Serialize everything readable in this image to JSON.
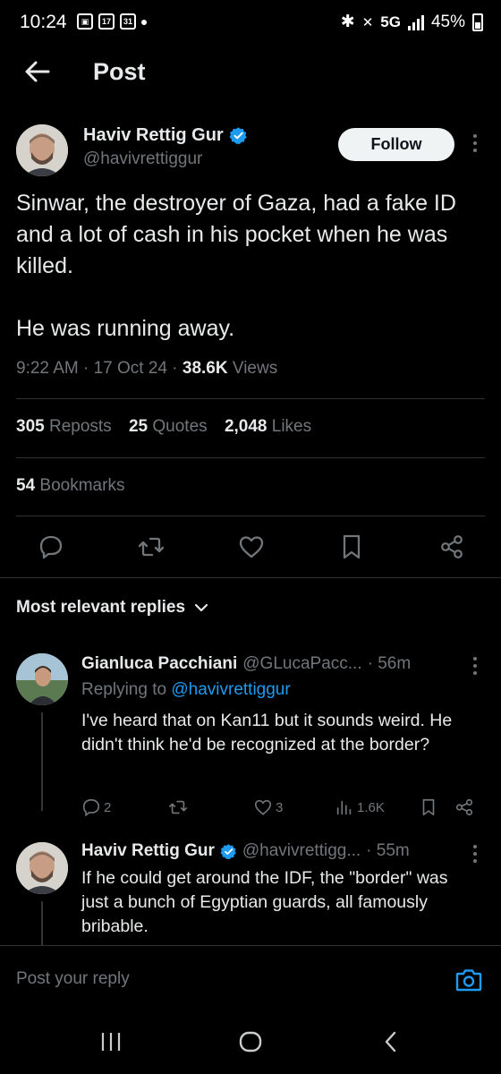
{
  "status_bar": {
    "time": "10:24",
    "cal_a": "17",
    "cal_b": "31",
    "network": "5G",
    "battery": "45%"
  },
  "header": {
    "title": "Post"
  },
  "post": {
    "author_name": "Haviv Rettig Gur",
    "author_handle": "@havivrettiggur",
    "follow_label": "Follow",
    "text_p1": "Sinwar, the destroyer of Gaza, had a fake ID and a lot of cash in his pocket when he was killed.",
    "text_p2": "He was running away.",
    "time": "9:22 AM",
    "date": "17 Oct 24",
    "views_count": "38.6K",
    "views_label": "Views",
    "reposts_count": "305",
    "reposts_label": "Reposts",
    "quotes_count": "25",
    "quotes_label": "Quotes",
    "likes_count": "2,048",
    "likes_label": "Likes",
    "bookmarks_count": "54",
    "bookmarks_label": "Bookmarks"
  },
  "replies_header": "Most relevant replies",
  "replies": [
    {
      "name": "Gianluca Pacchiani",
      "handle": "@GLucaPacc...",
      "time": "· 56m",
      "replying_prefix": "Replying to",
      "replying_to": "@havivrettiggur",
      "text": "I've heard that on Kan11 but it sounds weird. He didn't think he'd be recognized at the border?",
      "replies_count": "2",
      "likes_count": "3",
      "views_count": "1.6K"
    },
    {
      "name": "Haviv Rettig Gur",
      "handle": "@havivrettigg...",
      "time": "· 55m",
      "text": "If he could get around the IDF, the \"border\" was just a bunch of Egyptian guards, all famously bribable."
    }
  ],
  "composer": {
    "placeholder": "Post your reply"
  },
  "colors": {
    "background": "#000000",
    "text_primary": "#e7e9ea",
    "text_secondary": "#71767b",
    "accent_blue": "#1d9bf0",
    "divider": "#2f3336"
  },
  "icons": [
    "back-arrow-icon",
    "verified-badge-icon",
    "more-icon",
    "reply-icon",
    "repost-icon",
    "like-icon",
    "bookmark-icon",
    "share-icon",
    "chevron-down-icon",
    "views-icon",
    "camera-icon",
    "recents-icon",
    "home-icon",
    "back-icon"
  ]
}
